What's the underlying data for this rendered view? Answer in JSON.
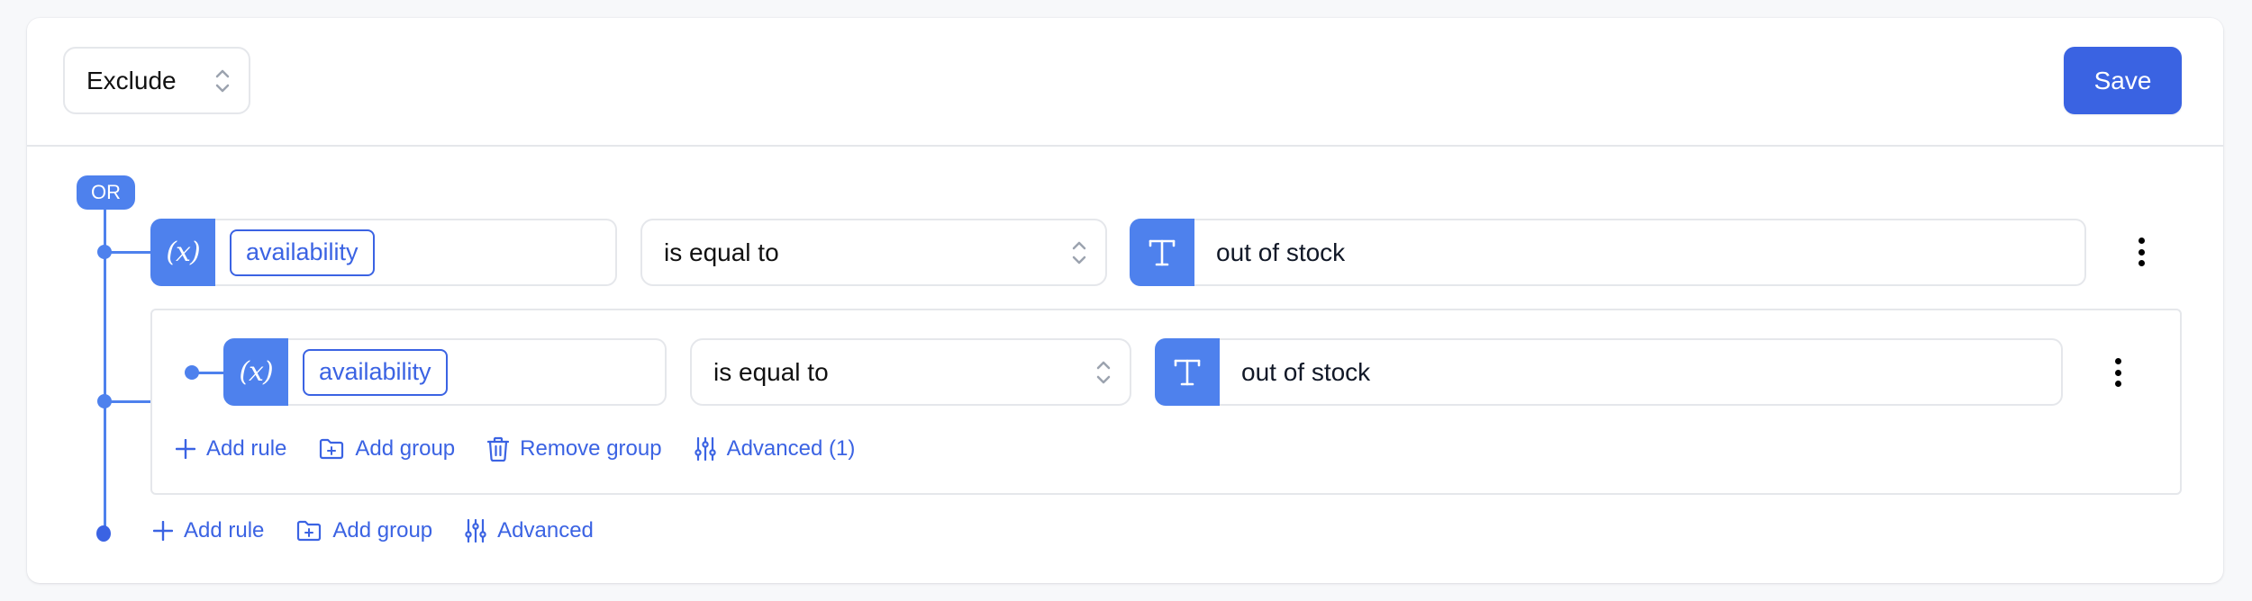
{
  "header": {
    "mode_select": {
      "value": "Exclude"
    },
    "save_label": "Save"
  },
  "root_group": {
    "combinator": "OR",
    "rules": [
      {
        "field": "availability",
        "field_type_icon": "variable-icon",
        "operator": "is equal to",
        "value_type_icon": "text-type-icon",
        "value": "out of stock"
      }
    ],
    "nested_group": {
      "rules": [
        {
          "field": "availability",
          "field_type_icon": "variable-icon",
          "operator": "is equal to",
          "value_type_icon": "text-type-icon",
          "value": "out of stock"
        }
      ],
      "actions": {
        "add_rule": "Add rule",
        "add_group": "Add group",
        "remove_group": "Remove group",
        "advanced": "Advanced (1)"
      }
    },
    "actions": {
      "add_rule": "Add rule",
      "add_group": "Add group",
      "advanced": "Advanced"
    }
  },
  "icons": {
    "variable": "(x)",
    "text_type": "T"
  },
  "colors": {
    "primary": "#3a63e2",
    "accent": "#4e81ed",
    "link": "#3b63e3",
    "border": "#e5e7eb",
    "background": "#f7f8fa"
  }
}
